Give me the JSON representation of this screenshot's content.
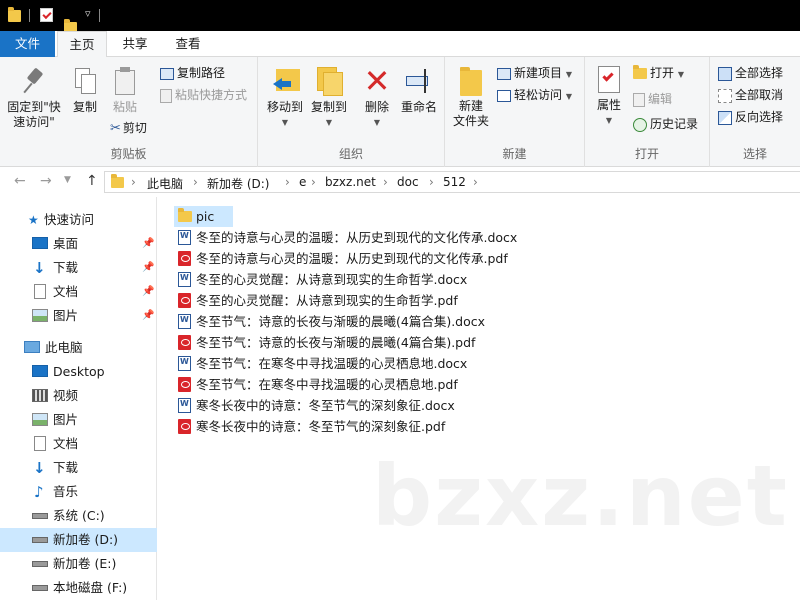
{
  "menu": {
    "file": "文件",
    "tabs": [
      "主页",
      "共享",
      "查看"
    ],
    "active_tab": 0
  },
  "ribbon": {
    "clipboard": {
      "pin_label": "固定到\"快速访问\"",
      "copy": "复制",
      "paste": "粘贴",
      "copy_path": "复制路径",
      "paste_shortcut": "粘贴快捷方式",
      "cut": "剪切",
      "group": "剪贴板"
    },
    "organize": {
      "move_to": "移动到",
      "copy_to": "复制到",
      "delete": "删除",
      "rename": "重命名",
      "group": "组织"
    },
    "new": {
      "new_folder": "新建\n文件夹",
      "new_item": "新建项目",
      "easy_access": "轻松访问",
      "group": "新建"
    },
    "open": {
      "properties": "属性",
      "open": "打开",
      "edit": "编辑",
      "history": "历史记录",
      "group": "打开"
    },
    "select": {
      "select_all": "全部选择",
      "select_none": "全部取消",
      "invert": "反向选择",
      "group": "选择"
    }
  },
  "address": {
    "crumbs": [
      "此电脑",
      "新加卷 (D:)",
      "e",
      "bzxz.net",
      "doc",
      "512"
    ]
  },
  "sidebar": {
    "quick_access": "快速访问",
    "quick_items": [
      "桌面",
      "下载",
      "文档",
      "图片"
    ],
    "this_pc": "此电脑",
    "pc_items": [
      "Desktop",
      "视频",
      "图片",
      "文档",
      "下载",
      "音乐",
      "系统 (C:)",
      "新加卷 (D:)",
      "新加卷 (E:)",
      "本地磁盘 (F:)"
    ]
  },
  "files": [
    {
      "name": "pic",
      "type": "folder"
    },
    {
      "name": "冬至的诗意与心灵的温暖：从历史到现代的文化传承.docx",
      "type": "docx"
    },
    {
      "name": "冬至的诗意与心灵的温暖：从历史到现代的文化传承.pdf",
      "type": "pdf"
    },
    {
      "name": "冬至的心灵觉醒：从诗意到现实的生命哲学.docx",
      "type": "docx"
    },
    {
      "name": "冬至的心灵觉醒：从诗意到现实的生命哲学.pdf",
      "type": "pdf"
    },
    {
      "name": "冬至节气：诗意的长夜与渐暖的晨曦(4篇合集).docx",
      "type": "docx"
    },
    {
      "name": "冬至节气：诗意的长夜与渐暖的晨曦(4篇合集).pdf",
      "type": "pdf"
    },
    {
      "name": "冬至节气：在寒冬中寻找温暖的心灵栖息地.docx",
      "type": "docx"
    },
    {
      "name": "冬至节气：在寒冬中寻找温暖的心灵栖息地.pdf",
      "type": "pdf"
    },
    {
      "name": "寒冬长夜中的诗意：冬至节气的深刻象征.docx",
      "type": "docx"
    },
    {
      "name": "寒冬长夜中的诗意：冬至节气的深刻象征.pdf",
      "type": "pdf"
    }
  ],
  "watermark": "bzxz.net",
  "colors": {
    "accent": "#1a73c6",
    "selection": "#cce8ff",
    "folder": "#f3c84a",
    "pdf": "#d9252a",
    "word": "#2b5797"
  }
}
